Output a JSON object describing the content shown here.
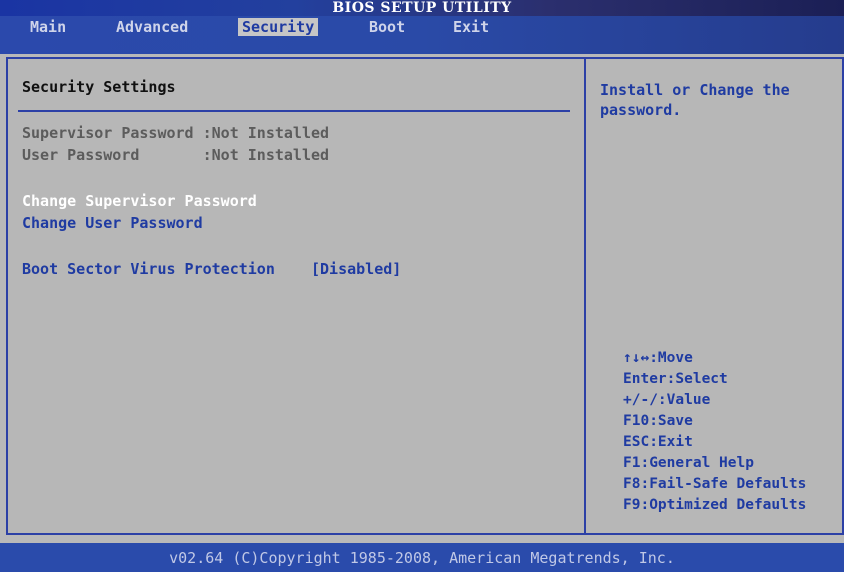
{
  "title": "BIOS SETUP UTILITY",
  "menu": {
    "items": [
      "Main",
      "Advanced",
      "Security",
      "Boot",
      "Exit"
    ],
    "active": "Security"
  },
  "main": {
    "section_title": "Security Settings",
    "supervisor_password_status": "Supervisor Password :Not Installed",
    "user_password_status": "User Password       :Not Installed",
    "change_supervisor_password": "Change Supervisor Password",
    "change_user_password": "Change User Password",
    "boot_sector_virus_protection": "Boot Sector Virus Protection    [Disabled]"
  },
  "help": {
    "description": "Install or Change the password.",
    "keys": [
      "↑↓↔:Move",
      "Enter:Select",
      "+/-/:Value",
      "F10:Save",
      "ESC:Exit",
      "F1:General Help",
      "F8:Fail-Safe Defaults",
      "F9:Optimized Defaults"
    ]
  },
  "footer": "v02.64 (C)Copyright 1985-2008, American Megatrends, Inc.",
  "colors": {
    "background": "#b9b9b9",
    "accent_blue": "#2c40a6",
    "text_blue": "#1f3ba2",
    "text_white": "#ffffff",
    "text_gray": "#5c5c5c"
  }
}
